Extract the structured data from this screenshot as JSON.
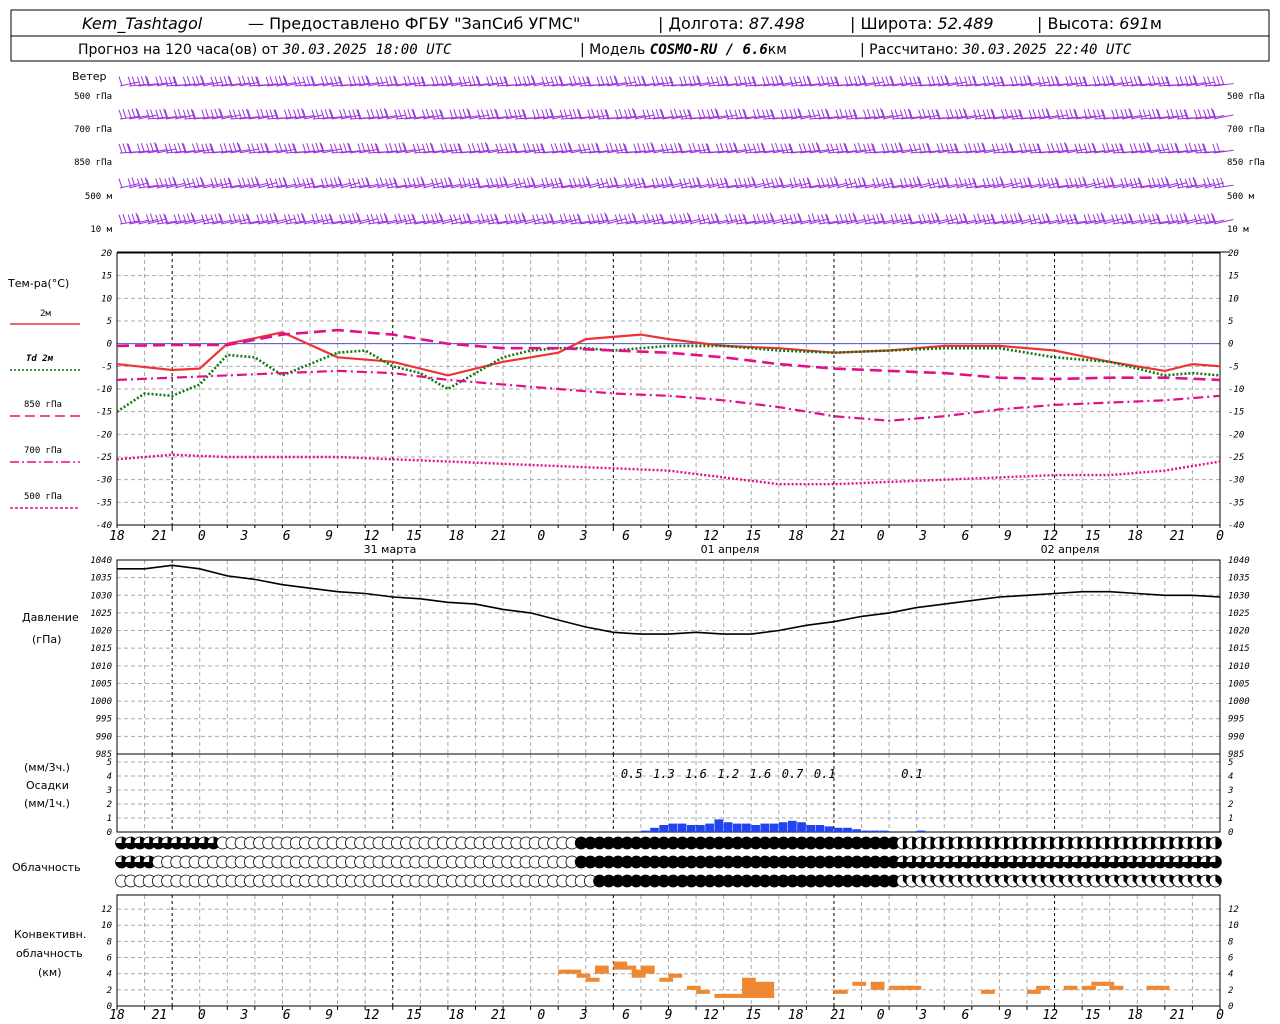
{
  "header": {
    "station": "Kem_Tashtagol",
    "provider": "Предоставлено ФГБУ \"ЗапСиб УГМС\"",
    "lon_label": "Долгота:",
    "lon": "87.498",
    "lat_label": "Широта:",
    "lat": "52.489",
    "alt_label": "Высота:",
    "alt": "691",
    "alt_unit": "м",
    "forecast_label": "Прогноз на 120 часа(ов) от",
    "forecast_start": "30.03.2025 18:00 UTC",
    "model_label": "Модель",
    "model": "COSMO-RU / 6.6",
    "model_unit": "км",
    "computed_label": "Рассчитано:",
    "computed": "30.03.2025 22:40 UTC"
  },
  "wind_panel": {
    "title": "Ветер",
    "levels": [
      "500 гПа",
      "700 гПа",
      "850 гПа",
      "500 м",
      "10 м"
    ],
    "color": "#9933dd"
  },
  "temp_panel": {
    "title": "Тем-ра(°C)",
    "legend": [
      {
        "label": "2м",
        "color": "#ee3333",
        "style": "solid"
      },
      {
        "label": "Td 2м",
        "color": "#117711",
        "style": "dotted"
      },
      {
        "label": "850 гПа",
        "color": "#e0108a",
        "style": "dashed"
      },
      {
        "label": "700 гПа",
        "color": "#e0108a",
        "style": "dashdot"
      },
      {
        "label": "500 гПа",
        "color": "#e0108a",
        "style": "dotted"
      }
    ],
    "y_ticks": [
      "20",
      "15",
      "10",
      "5",
      "0",
      "-5",
      "-10",
      "-15",
      "-20",
      "-25",
      "-30",
      "-35",
      "-40"
    ]
  },
  "time_axis": {
    "hour_labels": [
      "18",
      "21",
      "0",
      "3",
      "6",
      "9",
      "12",
      "15",
      "18",
      "21",
      "0",
      "3",
      "6",
      "9",
      "12",
      "15",
      "18",
      "21",
      "0",
      "3",
      "6",
      "9",
      "12",
      "15",
      "18",
      "21",
      "0"
    ],
    "dates": [
      "31 марта",
      "01 апреля",
      "02 апреля"
    ]
  },
  "pressure_panel": {
    "title": "Давление",
    "unit": "(гПа)",
    "y_ticks": [
      "1040",
      "1035",
      "1030",
      "1025",
      "1020",
      "1015",
      "1010",
      "1005",
      "1000",
      "995",
      "990",
      "985"
    ]
  },
  "precip_panel": {
    "title_line1": "(мм/3ч.)",
    "title_line2": "Осадки",
    "title_line3": "(мм/1ч.)",
    "y_ticks": [
      "5",
      "4",
      "3",
      "2",
      "1",
      "0"
    ],
    "totals_3h": [
      "0.5",
      "1.3",
      "1.6",
      "1.2",
      "1.6",
      "0.7",
      "0.1",
      "0.1"
    ],
    "bar_color": "#2244ee"
  },
  "cloud_panel": {
    "title": "Облачность"
  },
  "conv_panel": {
    "title_line1": "Конвективн.",
    "title_line2": "облачность",
    "title_line3": "(км)",
    "y_ticks": [
      "12",
      "10",
      "8",
      "6",
      "4",
      "2",
      "0"
    ],
    "bar_color": "#ee8833"
  },
  "chart_data": {
    "type": "line",
    "x_unit": "hours since 30.03.2025 18:00 UTC",
    "temperature": {
      "ylim": [
        -40,
        20
      ],
      "series": [
        {
          "name": "2м",
          "x": [
            0,
            6,
            9,
            12,
            15,
            18,
            24,
            30,
            36,
            42,
            45,
            48,
            51,
            54,
            57,
            60,
            66,
            72,
            78,
            84,
            90,
            96,
            102,
            108,
            114,
            117,
            120
          ],
          "values": [
            -4.5,
            -5.8,
            -5.5,
            0,
            1.2,
            2.5,
            -3,
            -4,
            -7,
            -4,
            -3,
            -2,
            1,
            1.5,
            2,
            1,
            -0.5,
            -1,
            -2,
            -1.5,
            -0.5,
            -0.5,
            -1.5,
            -4,
            -6,
            -4.5,
            -5
          ]
        },
        {
          "name": "Td 2м",
          "x": [
            0,
            3,
            6,
            9,
            12,
            15,
            18,
            24,
            27,
            30,
            33,
            36,
            42,
            45,
            48,
            51,
            54,
            60,
            66,
            72,
            78,
            84,
            90,
            96,
            102,
            108,
            114,
            117,
            120
          ],
          "values": [
            -15,
            -11,
            -11.5,
            -9,
            -2.5,
            -3,
            -7,
            -2,
            -1.5,
            -5,
            -6.5,
            -10,
            -3,
            -1.5,
            -1,
            -1,
            -1.5,
            -0.5,
            -0.5,
            -1.5,
            -2,
            -1.5,
            -1,
            -1,
            -3,
            -4,
            -7,
            -6.5,
            -7
          ]
        },
        {
          "name": "850 гПа",
          "x": [
            0,
            6,
            12,
            18,
            24,
            30,
            36,
            42,
            48,
            54,
            60,
            66,
            72,
            78,
            84,
            90,
            96,
            102,
            108,
            114,
            120
          ],
          "values": [
            -0.5,
            -0.3,
            -0.3,
            2,
            3,
            2,
            0,
            -1,
            -1,
            -1.5,
            -2,
            -3,
            -4.5,
            -5.5,
            -6,
            -6.5,
            -7.5,
            -7.8,
            -7.5,
            -7.5,
            -8
          ]
        },
        {
          "name": "700 гПа",
          "x": [
            0,
            6,
            12,
            18,
            24,
            30,
            36,
            42,
            48,
            54,
            60,
            66,
            72,
            78,
            84,
            90,
            96,
            102,
            108,
            114,
            120
          ],
          "values": [
            -8,
            -7.5,
            -7,
            -6.5,
            -6,
            -6.5,
            -8,
            -9,
            -10,
            -11,
            -11.5,
            -12.5,
            -14,
            -16,
            -17,
            -16,
            -14.5,
            -13.5,
            -13,
            -12.5,
            -11.5
          ]
        },
        {
          "name": "500 гПа",
          "x": [
            0,
            6,
            12,
            18,
            24,
            30,
            36,
            42,
            48,
            54,
            60,
            66,
            72,
            78,
            84,
            90,
            96,
            102,
            108,
            114,
            120
          ],
          "values": [
            -25.5,
            -24.5,
            -25,
            -25,
            -25,
            -25.5,
            -26,
            -26.5,
            -27,
            -27.5,
            -28,
            -29.5,
            -31,
            -31,
            -30.5,
            -30,
            -29.5,
            -29,
            -29,
            -28,
            -26
          ]
        }
      ]
    },
    "pressure": {
      "ylim": [
        985,
        1040
      ],
      "x": [
        0,
        3,
        6,
        9,
        12,
        15,
        18,
        21,
        24,
        27,
        30,
        33,
        36,
        39,
        42,
        45,
        48,
        51,
        54,
        57,
        60,
        63,
        66,
        69,
        72,
        75,
        78,
        81,
        84,
        87,
        90,
        93,
        96,
        99,
        102,
        105,
        108,
        111,
        114,
        117,
        120
      ],
      "values": [
        1037.5,
        1037.5,
        1038.5,
        1037.5,
        1035.5,
        1034.5,
        1033,
        1032,
        1031,
        1030.5,
        1029.5,
        1029,
        1028,
        1027.5,
        1026,
        1025,
        1023,
        1021,
        1019.5,
        1019,
        1019,
        1019.5,
        1019,
        1019,
        1020,
        1021.5,
        1022.5,
        1024,
        1025,
        1026.5,
        1027.5,
        1028.5,
        1029.5,
        1030,
        1030.5,
        1031,
        1031,
        1030.5,
        1030,
        1030,
        1029.5
      ]
    },
    "precipitation_1h": {
      "ylim": [
        0,
        5
      ],
      "x": [
        57,
        58,
        59,
        60,
        61,
        62,
        63,
        64,
        65,
        66,
        67,
        68,
        69,
        70,
        71,
        72,
        73,
        74,
        75,
        76,
        77,
        78,
        79,
        80,
        81,
        82,
        83,
        87
      ],
      "values": [
        0.1,
        0.3,
        0.5,
        0.6,
        0.6,
        0.5,
        0.5,
        0.6,
        0.9,
        0.7,
        0.6,
        0.6,
        0.5,
        0.6,
        0.6,
        0.7,
        0.8,
        0.7,
        0.5,
        0.5,
        0.4,
        0.3,
        0.3,
        0.2,
        0.1,
        0.1,
        0.1,
        0.1
      ]
    },
    "convective_cloud": {
      "ylim": [
        0,
        13
      ],
      "bars": [
        {
          "x": 48,
          "base": 4,
          "top": 4.5
        },
        {
          "x": 49,
          "base": 4,
          "top": 4.5
        },
        {
          "x": 50,
          "base": 3.5,
          "top": 4
        },
        {
          "x": 51,
          "base": 3,
          "top": 3.5
        },
        {
          "x": 52,
          "base": 4,
          "top": 5
        },
        {
          "x": 54,
          "base": 4.5,
          "top": 5.5
        },
        {
          "x": 55,
          "base": 4.5,
          "top": 5
        },
        {
          "x": 56,
          "base": 3.5,
          "top": 4.5
        },
        {
          "x": 57,
          "base": 4,
          "top": 5
        },
        {
          "x": 59,
          "base": 3,
          "top": 3.5
        },
        {
          "x": 60,
          "base": 3.5,
          "top": 4
        },
        {
          "x": 62,
          "base": 2,
          "top": 2.5
        },
        {
          "x": 63,
          "base": 1.5,
          "top": 2
        },
        {
          "x": 65,
          "base": 1,
          "top": 1.5
        },
        {
          "x": 66,
          "base": 1,
          "top": 1.5
        },
        {
          "x": 67,
          "base": 1,
          "top": 1.5
        },
        {
          "x": 68,
          "base": 1,
          "top": 3.5
        },
        {
          "x": 69,
          "base": 1,
          "top": 3
        },
        {
          "x": 70,
          "base": 1,
          "top": 3
        },
        {
          "x": 78,
          "base": 1.5,
          "top": 2
        },
        {
          "x": 80,
          "base": 2.5,
          "top": 3
        },
        {
          "x": 82,
          "base": 2,
          "top": 3
        },
        {
          "x": 84,
          "base": 2,
          "top": 2.5
        },
        {
          "x": 85,
          "base": 2,
          "top": 2.5
        },
        {
          "x": 86,
          "base": 2,
          "top": 2.5
        },
        {
          "x": 94,
          "base": 1.5,
          "top": 2
        },
        {
          "x": 99,
          "base": 1.5,
          "top": 2
        },
        {
          "x": 100,
          "base": 2,
          "top": 2.5
        },
        {
          "x": 103,
          "base": 2,
          "top": 2.5
        },
        {
          "x": 105,
          "base": 2,
          "top": 2.5
        },
        {
          "x": 106,
          "base": 2.5,
          "top": 3
        },
        {
          "x": 107,
          "base": 2.5,
          "top": 3
        },
        {
          "x": 108,
          "base": 2,
          "top": 2.5
        },
        {
          "x": 112,
          "base": 2,
          "top": 2.5
        },
        {
          "x": 113,
          "base": 2,
          "top": 2.5
        }
      ]
    },
    "wind_direction_deg": {
      "levels": [
        "500 гПа",
        "700 гПа",
        "850 гПа",
        "500 м",
        "10 м"
      ],
      "x_step_h": 1,
      "notes": "wind barbs, westerly flow at upper levels"
    },
    "cloud_cover_eighths": {
      "rows": [
        "low",
        "mid",
        "high"
      ],
      "segments": [
        {
          "row": 0,
          "from": 0,
          "to": 11,
          "value": 6
        },
        {
          "row": 0,
          "from": 11,
          "to": 50,
          "value": 0
        },
        {
          "row": 0,
          "from": 50,
          "to": 85,
          "value": 8
        },
        {
          "row": 0,
          "from": 85,
          "to": 120,
          "value": 4
        },
        {
          "row": 1,
          "from": 0,
          "to": 4,
          "value": 6
        },
        {
          "row": 1,
          "from": 4,
          "to": 50,
          "value": 0
        },
        {
          "row": 1,
          "from": 50,
          "to": 85,
          "value": 8
        },
        {
          "row": 1,
          "from": 85,
          "to": 120,
          "value": 6
        },
        {
          "row": 2,
          "from": 0,
          "to": 52,
          "value": 0
        },
        {
          "row": 2,
          "from": 52,
          "to": 85,
          "value": 8
        },
        {
          "row": 2,
          "from": 85,
          "to": 120,
          "value": 3
        }
      ]
    }
  }
}
